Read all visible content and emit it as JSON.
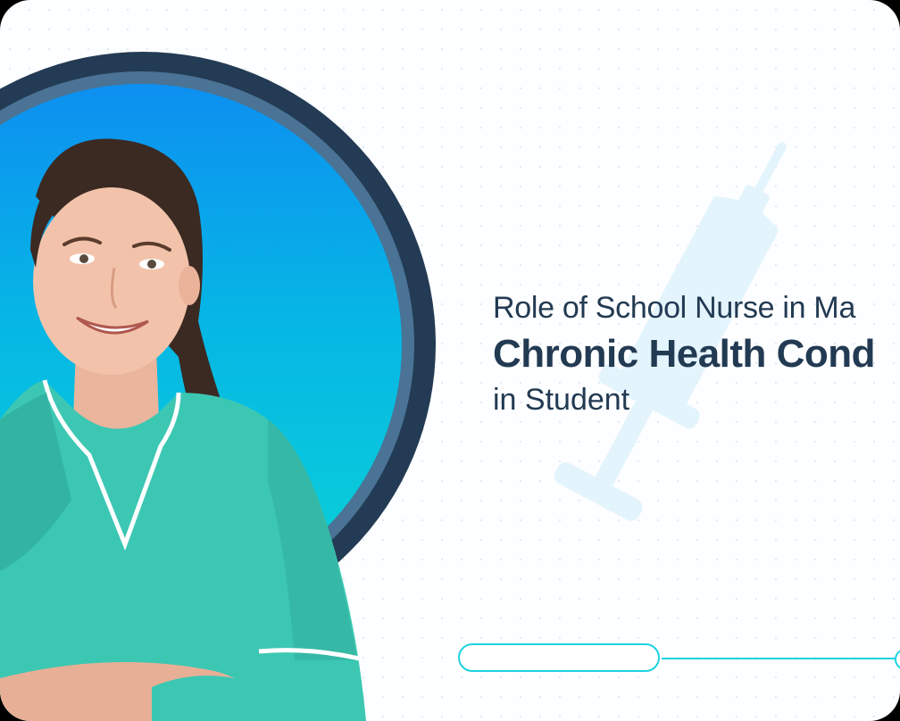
{
  "banner": {
    "title_line1": "Role of School Nurse in Ma",
    "title_line2": "Chronic Health Cond",
    "title_line3": "in Student"
  },
  "colors": {
    "text": "#223a52",
    "ring_dark": "#233b54",
    "ring_mid": "#4a7395",
    "circle_top": "#0d8ff0",
    "circle_bottom": "#0ad3d6",
    "scrubs": "#3cc7b3",
    "accent_line": "#1dd3e0",
    "syringe": "#e4f4fd"
  },
  "icons": {
    "background": "syringe-icon",
    "progress": "slide-progress"
  }
}
